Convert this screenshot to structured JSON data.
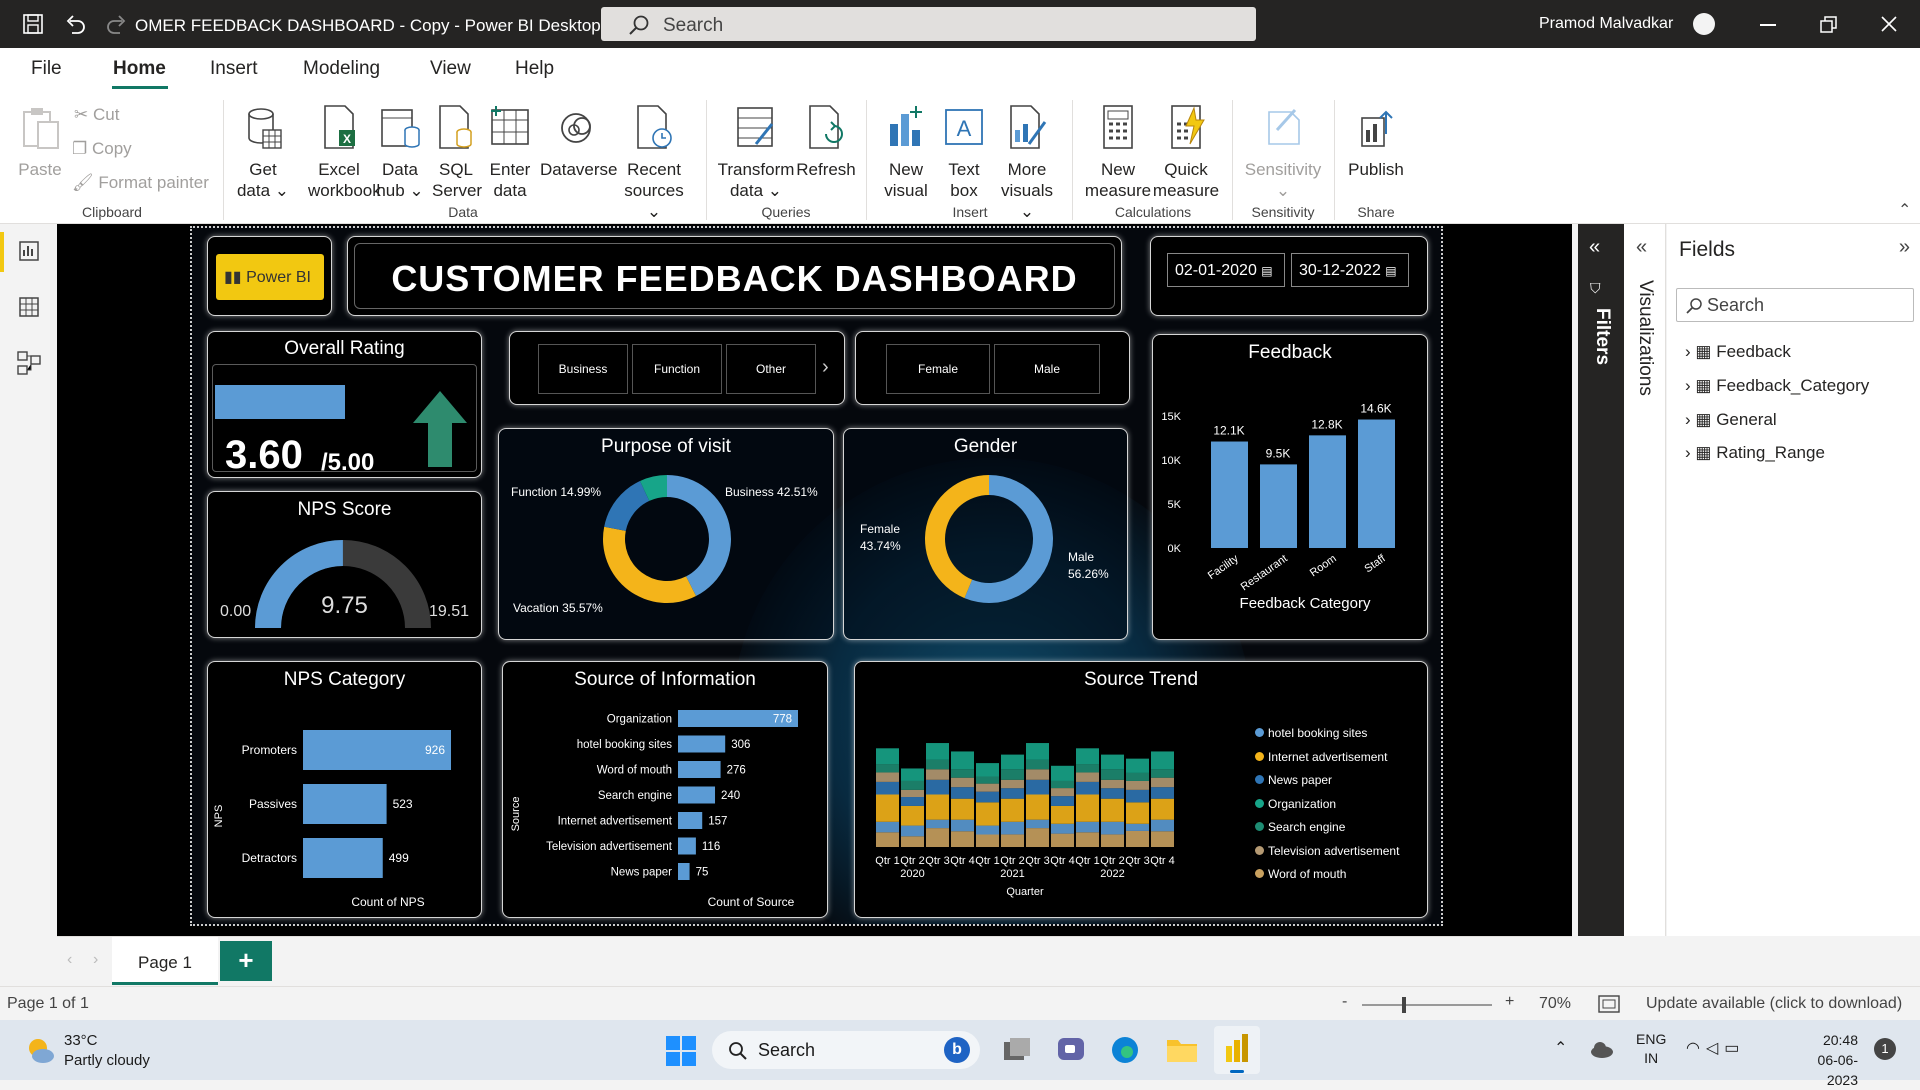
{
  "app": {
    "title": "OMER FEEDBACK DASHBOARD - Copy - Power BI Desktop",
    "search": "Search",
    "user": "Pramod Malvadkar"
  },
  "menu": {
    "file": "File",
    "home": "Home",
    "insert": "Insert",
    "modeling": "Modeling",
    "view": "View",
    "help": "Help"
  },
  "ribbon": {
    "paste": "Paste",
    "cut": "Cut",
    "copy": "Copy",
    "format_painter": "Format painter",
    "clipboard": "Clipboard",
    "get_data": [
      "Get",
      "data ⌄"
    ],
    "excel": [
      "Excel",
      "workbook"
    ],
    "data_hub": [
      "Data",
      "hub ⌄"
    ],
    "sql": [
      "SQL",
      "Server"
    ],
    "enter_data": [
      "Enter",
      "data"
    ],
    "dataverse": "Dataverse",
    "recent": [
      "Recent",
      "sources ⌄"
    ],
    "data": "Data",
    "transform": [
      "Transform",
      "data ⌄"
    ],
    "refresh": "Refresh",
    "queries": "Queries",
    "new_visual": [
      "New",
      "visual"
    ],
    "text_box": [
      "Text",
      "box"
    ],
    "more_visuals": [
      "More",
      "visuals ⌄"
    ],
    "insert": "Insert",
    "new_measure": [
      "New",
      "measure"
    ],
    "quick_measure": [
      "Quick",
      "measure"
    ],
    "calculations": "Calculations",
    "sensitivity": "Sensitivity",
    "sensitivity_arrow": "⌄",
    "sensitivity_group": "Sensitivity",
    "publish": "Publish",
    "share": "Share"
  },
  "dashboard": {
    "logo": "Power BI",
    "title": "CUSTOMER FEEDBACK DASHBOARD",
    "date_from": "02-01-2020",
    "date_to": "30-12-2022",
    "overall": {
      "title": "Overall Rating",
      "value": "3.60",
      "suffix": "/5.00",
      "fill": 0.72
    },
    "nps": {
      "title": "NPS Score",
      "value": "9.75",
      "min": "0.00",
      "max": "19.51"
    },
    "slicer_purpose": [
      "Business",
      "Function",
      "Other"
    ],
    "slicer_gender": [
      "Female",
      "Male"
    ],
    "purpose": {
      "title": "Purpose of visit",
      "labels": [
        "Function 14.99%",
        "Business 42.51%",
        "Vacation 35.57%"
      ]
    },
    "gender": {
      "title": "Gender",
      "female": [
        "Female",
        "43.74%"
      ],
      "male": [
        "Male",
        "56.26%"
      ]
    },
    "feedback": {
      "title": "Feedback",
      "xlabel": "Feedback Category"
    },
    "nps_category": {
      "title": "NPS Category",
      "xlabel": "Count of NPS",
      "ylabel": "NPS"
    },
    "source": {
      "title": "Source of Information",
      "xlabel": "Count of Source",
      "ylabel": "Source"
    },
    "trend": {
      "title": "Source Trend",
      "xlabel": "Quarter",
      "years": [
        "2020",
        "2021",
        "2022"
      ],
      "quarters": [
        "Qtr 1",
        "Qtr 2",
        "Qtr 3",
        "Qtr 4"
      ],
      "legend": [
        {
          "name": "hotel booking sites",
          "color": "#5b9bd5"
        },
        {
          "name": "Internet advertisement",
          "color": "#f4b41a"
        },
        {
          "name": "News paper",
          "color": "#2f75b5"
        },
        {
          "name": "Organization",
          "color": "#17a589"
        },
        {
          "name": "Search engine",
          "color": "#1e8c73"
        },
        {
          "name": "Television advertisement",
          "color": "#b59a73"
        },
        {
          "name": "Word of mouth",
          "color": "#c9a15f"
        }
      ]
    }
  },
  "chart_data": [
    {
      "type": "bar",
      "title": "Feedback",
      "categories": [
        "Facility",
        "Restaurant",
        "Room",
        "Staff"
      ],
      "values": [
        12.1,
        9.5,
        12.8,
        14.6
      ],
      "labels": [
        "12.1K",
        "9.5K",
        "12.8K",
        "14.6K"
      ],
      "ylim": [
        0,
        15
      ],
      "yticks": [
        "0K",
        "5K",
        "10K",
        "15K"
      ],
      "xlabel": "Feedback Category"
    },
    {
      "type": "bar",
      "title": "NPS Category",
      "orientation": "horizontal",
      "categories": [
        "Promoters",
        "Passives",
        "Detractors"
      ],
      "values": [
        926,
        523,
        499
      ],
      "xlabel": "Count of NPS",
      "ylabel": "NPS"
    },
    {
      "type": "bar",
      "title": "Source of Information",
      "orientation": "horizontal",
      "categories": [
        "Organization",
        "hotel booking sites",
        "Word of mouth",
        "Search engine",
        "Internet advertisement",
        "Television advertisement",
        "News paper"
      ],
      "values": [
        778,
        306,
        276,
        240,
        157,
        116,
        75
      ],
      "xlabel": "Count of Source",
      "ylabel": "Source"
    },
    {
      "type": "pie",
      "title": "Purpose of visit",
      "categories": [
        "Business",
        "Vacation",
        "Function",
        "Other"
      ],
      "values": [
        42.51,
        35.57,
        14.99,
        6.93
      ],
      "colors": [
        "#5b9bd5",
        "#f4b41a",
        "#2f75b5",
        "#17a589"
      ]
    },
    {
      "type": "pie",
      "title": "Gender",
      "categories": [
        "Male",
        "Female"
      ],
      "values": [
        56.26,
        43.74
      ],
      "colors": [
        "#5b9bd5",
        "#f4b41a"
      ]
    }
  ],
  "panes": {
    "filters": "Filters",
    "visualizations": "Visualizations",
    "fields": "Fields",
    "search": "Search",
    "tables": [
      "Feedback",
      "Feedback_Category",
      "General",
      "Rating_Range"
    ]
  },
  "pages": {
    "page1": "Page 1",
    "add": "+"
  },
  "status": {
    "page": "Page 1 of 1",
    "zoom": "70%",
    "update": "Update available (click to download)"
  },
  "taskbar": {
    "temp": "33°C",
    "weather": "Partly cloudy",
    "search": "Search",
    "lang1": "ENG",
    "lang2": "IN",
    "time": "20:48",
    "date": "06-06-2023",
    "notif": "1"
  },
  "colors": {
    "accent": "#f2c811",
    "bar": "#5b9bd5",
    "teal": "#17a589",
    "green_arrow": "#2e8b6e"
  }
}
